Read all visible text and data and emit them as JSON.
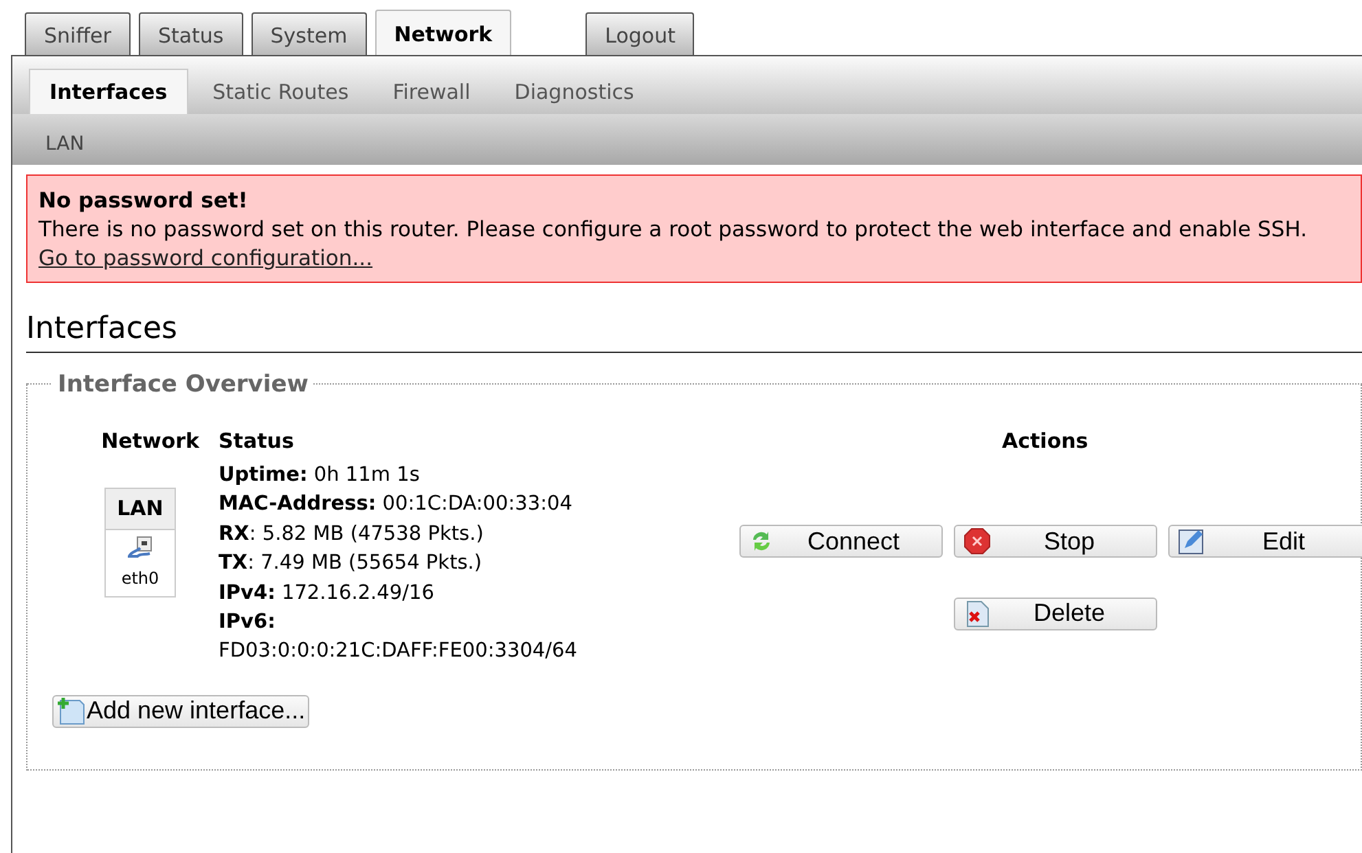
{
  "main_tabs": [
    {
      "label": "Sniffer",
      "selected": false
    },
    {
      "label": "Status",
      "selected": false
    },
    {
      "label": "System",
      "selected": false
    },
    {
      "label": "Network",
      "selected": true
    },
    {
      "label": "Logout",
      "selected": false
    }
  ],
  "sub_tabs": [
    {
      "label": "Interfaces",
      "selected": true
    },
    {
      "label": "Static Routes",
      "selected": false
    },
    {
      "label": "Firewall",
      "selected": false
    },
    {
      "label": "Diagnostics",
      "selected": false
    }
  ],
  "third_tabs": [
    {
      "label": "LAN",
      "selected": false
    }
  ],
  "alert": {
    "title": "No password set!",
    "message": "There is no password set on this router. Please configure a root password to protect the web interface and enable SSH.",
    "link": "Go to password configuration..."
  },
  "heading": "Interfaces",
  "overview": {
    "legend": "Interface Overview",
    "columns": [
      "Network",
      "Status",
      "Actions"
    ],
    "rows": [
      {
        "network": "LAN",
        "device": "eth0",
        "status_lines": [
          "**Uptime:** 0h 11m 1s",
          "**MAC-Address:** 00:1C:DA:00:33:04",
          "**RX**: 5.82 MB (47538 Pkts.)",
          "**TX**: 7.49 MB (55654 Pkts.)",
          "**IPv4:** 172.16.2.49/16",
          "**IPv6:**",
          "FD03:0:0:0:21C:DAFF:FE00:3304/64"
        ],
        "actions": [
          {
            "kind": "connect",
            "label": "Connect"
          },
          {
            "kind": "stop",
            "label": "Stop"
          },
          {
            "kind": "edit",
            "label": "Edit"
          },
          {
            "kind": "delete",
            "label": "Delete"
          }
        ]
      }
    ],
    "add_button": "Add new interface..."
  }
}
